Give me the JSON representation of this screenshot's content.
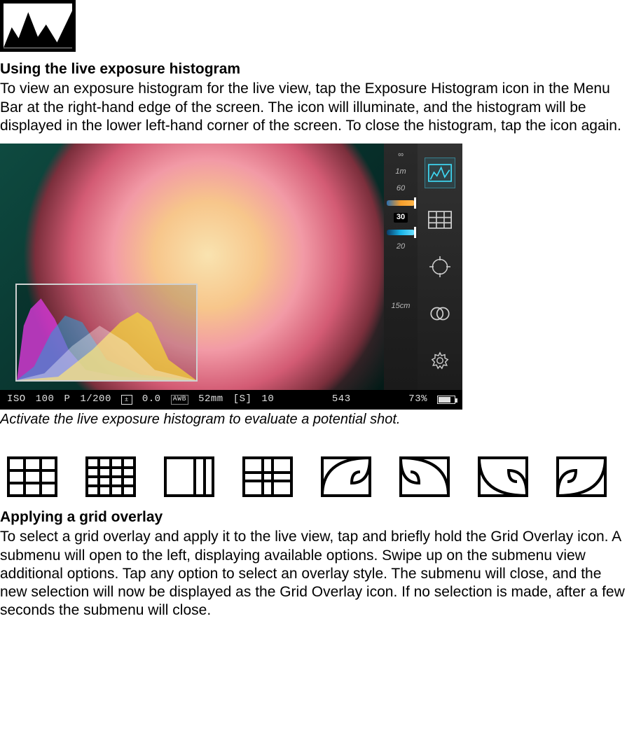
{
  "histogram": {
    "heading": "Using the live exposure histogram",
    "body": "To view an exposure histogram for the live view, tap the Exposure Histogram icon in the Menu Bar at the right-hand edge of the screen. The icon will illuminate, and the histogram will be displayed in the lower left-hand corner of the screen. To close the histogram, tap the icon again.",
    "caption": "Activate the live exposure histogram to evaluate a potential shot."
  },
  "liveview": {
    "focus_scale": {
      "inf": "∞",
      "t1": "1m",
      "t2": "60",
      "highlight": "30",
      "t3": "20",
      "t4": "15cm"
    },
    "status": {
      "iso_label": "ISO",
      "iso_value": "100",
      "mode": "P",
      "shutter": "1/200",
      "ev_symbol": "±",
      "ev": "0.0",
      "awb": "AWB",
      "focal": "52mm",
      "sbracket": "[S]",
      "count1": "10",
      "count2": "543",
      "battery": "73%"
    }
  },
  "grid": {
    "heading": "Applying a grid overlay",
    "body": "To select a grid overlay and apply it to the live view, tap and briefly hold the Grid Overlay icon. A submenu will open to the left, displaying available options. Swipe up on the submenu view additional options. Tap any option to select an overlay style. The submenu will close, and the new selection will now be displayed as the Grid Overlay icon. If no selection is made, after a few seconds the submenu will close."
  }
}
